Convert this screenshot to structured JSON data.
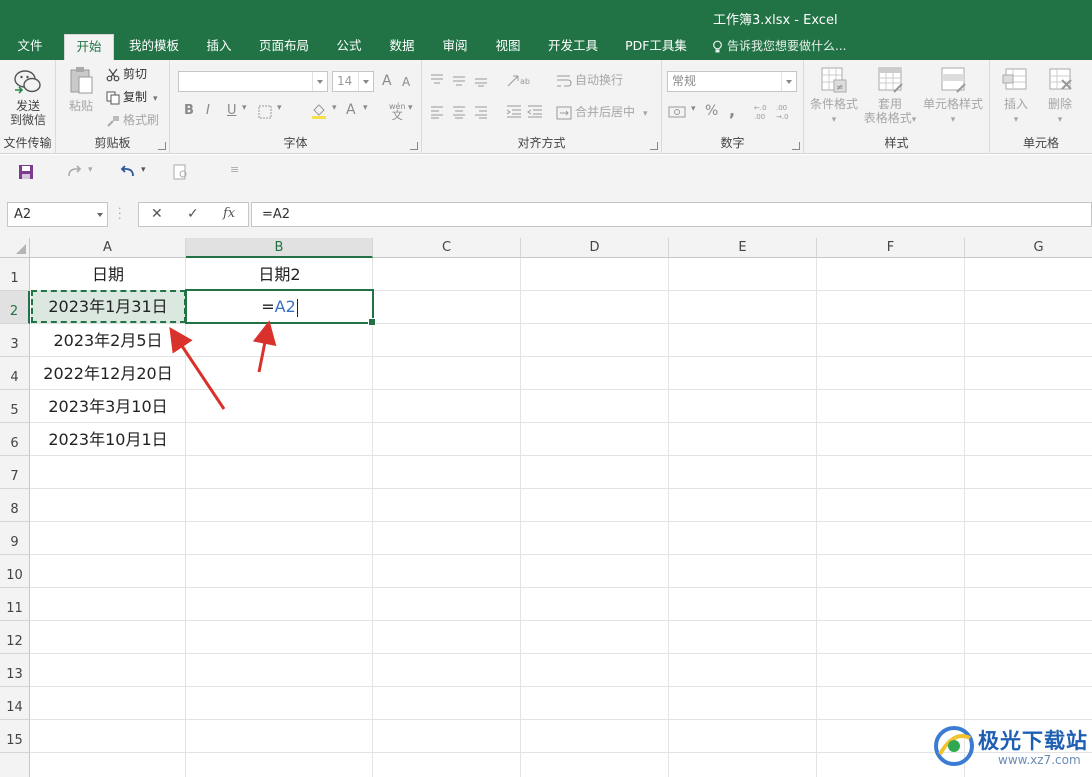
{
  "window": {
    "title": "工作簿3.xlsx - Excel"
  },
  "menu": {
    "tabs": [
      "文件",
      "开始",
      "我的模板",
      "插入",
      "页面布局",
      "公式",
      "数据",
      "审阅",
      "视图",
      "开发工具",
      "PDF工具集"
    ],
    "active": "开始",
    "tellme": "告诉我您想要做什么..."
  },
  "ribbon": {
    "wechat": {
      "label_line1": "发送",
      "label_line2": "到微信",
      "group": "文件传输"
    },
    "clipboard": {
      "paste": "粘贴",
      "cut": "剪切",
      "copy": "复制",
      "format_painter": "格式刷",
      "group": "剪贴板"
    },
    "font": {
      "font_name": "",
      "font_size": "14",
      "bold": "B",
      "italic": "I",
      "underline": "U",
      "grow": "A",
      "shrink": "A",
      "wen": "wén",
      "wen_char": "文",
      "color_a": "A",
      "group": "字体"
    },
    "alignment": {
      "wrap": "自动换行",
      "merge": "合并后居中",
      "group": "对齐方式"
    },
    "number": {
      "format": "常规",
      "percent": "%",
      "comma": ",",
      "group": "数字"
    },
    "styles": {
      "conditional": "条件格式",
      "table_l1": "套用",
      "table_l2": "表格格式",
      "cell_styles": "单元格样式",
      "group": "样式"
    },
    "cells": {
      "insert": "插入",
      "delete": "删除",
      "group": "单元格"
    }
  },
  "formula_bar": {
    "name_box": "A2",
    "cancel": "✕",
    "enter": "✓",
    "fx": "fx",
    "formula": "=A2"
  },
  "sheet": {
    "columns": [
      "A",
      "B",
      "C",
      "D",
      "E",
      "F",
      "G"
    ],
    "selected_column": "B",
    "rows": [
      "1",
      "2",
      "3",
      "4",
      "5",
      "6",
      "7",
      "8",
      "9",
      "10",
      "11",
      "12",
      "13",
      "14",
      "15"
    ],
    "selected_row": "2",
    "A1": "日期",
    "B1": "日期2",
    "A2": "2023年1月31日",
    "A3": "2023年2月5日",
    "A4": "2022年12月20日",
    "A5": "2023年3月10日",
    "A6": "2023年10月1日",
    "B2_eq": "=",
    "B2_ref": "A2"
  },
  "watermark": {
    "text": "极光下载站",
    "url": "www.xz7.com"
  },
  "colors": {
    "excel_green": "#217346",
    "ref_blue": "#3a6fc4",
    "arrow_red": "#d9312b"
  }
}
